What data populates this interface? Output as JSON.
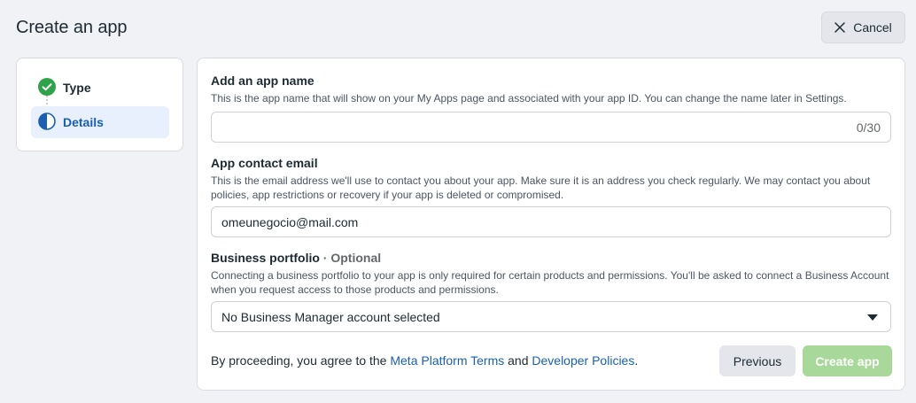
{
  "header": {
    "title": "Create an app",
    "cancel_label": "Cancel"
  },
  "steps": [
    {
      "label": "Type",
      "state": "complete",
      "icon": "check-circle-icon"
    },
    {
      "label": "Details",
      "state": "active",
      "icon": "half-circle-icon"
    }
  ],
  "form": {
    "app_name": {
      "title": "Add an app name",
      "description": "This is the app name that will show on your My Apps page and associated with your app ID. You can change the name later in Settings.",
      "value": "",
      "counter": "0/30"
    },
    "contact_email": {
      "title": "App contact email",
      "description": "This is the email address we'll use to contact you about your app. Make sure it is an address you check regularly. We may contact you about policies, app restrictions or recovery if your app is deleted or compromised.",
      "value": "omeunegocio@mail.com"
    },
    "business_portfolio": {
      "title": "Business portfolio",
      "optional_label": "· Optional",
      "description": "Connecting a business portfolio to your app is only required for certain products and permissions. You'll be asked to connect a Business Account when you request access to those products and permissions.",
      "selected": "No Business Manager account selected"
    }
  },
  "footer": {
    "agree_prefix": "By proceeding, you agree to the",
    "terms_link": "Meta Platform Terms",
    "and_text": "and",
    "policies_link": "Developer Policies",
    "suffix": ".",
    "previous_label": "Previous",
    "create_label": "Create app"
  },
  "colors": {
    "accent": "#1a5fb4",
    "success": "#31a24c",
    "create_disabled": "#a8d99a"
  }
}
